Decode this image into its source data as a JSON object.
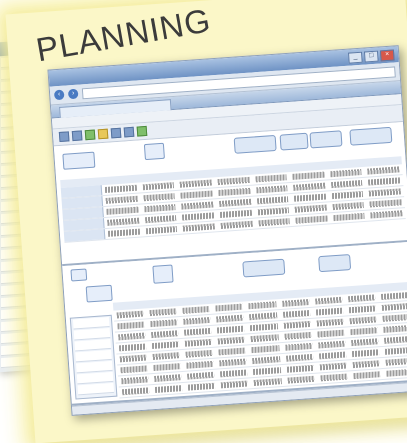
{
  "title": "PLANNING",
  "window": {
    "controls": {
      "minimize": "_",
      "maximize": "□",
      "close": "×"
    }
  },
  "icons": {
    "back": "arrow-left-icon",
    "forward": "arrow-right-icon"
  },
  "colors": {
    "note": "#fbf7c8",
    "titlebar": "#6e92c4",
    "title_text": "#3b3b3b"
  }
}
